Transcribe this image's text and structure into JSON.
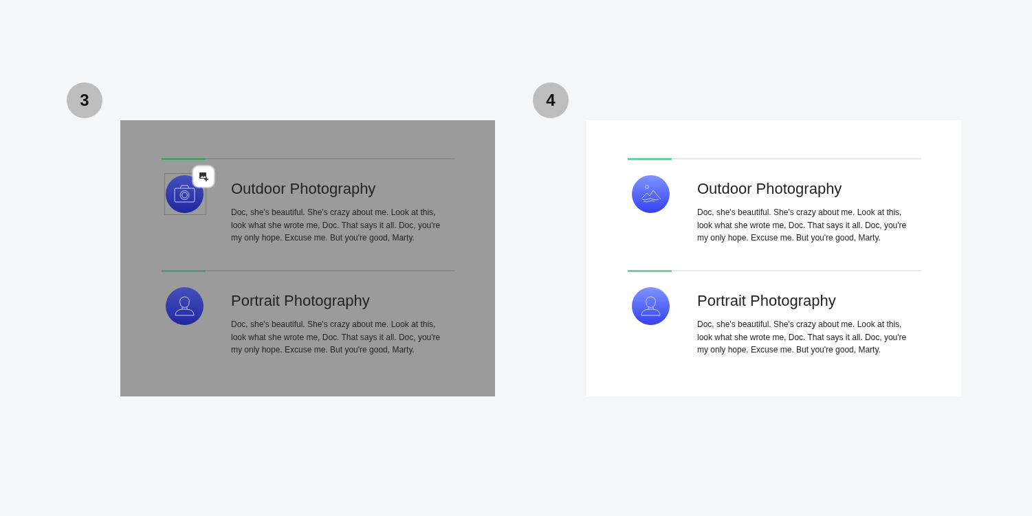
{
  "steps": [
    {
      "number": "3",
      "dimmed": true,
      "items": [
        {
          "kind": "camera",
          "selected": true,
          "title": "Outdoor Photography",
          "body": "Doc, she's beautiful. She's crazy about me. Look at this, look what she wrote me, Doc. That says it all. Doc, you're my only hope. Excuse me. But you're good, Marty."
        },
        {
          "kind": "person",
          "selected": false,
          "title": "Portrait Photography",
          "body": "Doc, she's beautiful. She's crazy about me. Look at this, look what she wrote me, Doc. That says it all. Doc, you're my only hope. Excuse me. But you're good, Marty."
        }
      ]
    },
    {
      "number": "4",
      "dimmed": false,
      "items": [
        {
          "kind": "mountain",
          "selected": false,
          "title": "Outdoor Photography",
          "body": "Doc, she's beautiful. She's crazy about me. Look at this, look what she wrote me, Doc. That says it all. Doc, you're my only hope. Excuse me. But you're good, Marty."
        },
        {
          "kind": "person",
          "selected": false,
          "title": "Portrait Photography",
          "body": "Doc, she's beautiful. She's crazy about me. Look at this, look what she wrote me, Doc. That says it all. Doc, you're my only hope. Excuse me. But you're good, Marty."
        }
      ]
    }
  ]
}
